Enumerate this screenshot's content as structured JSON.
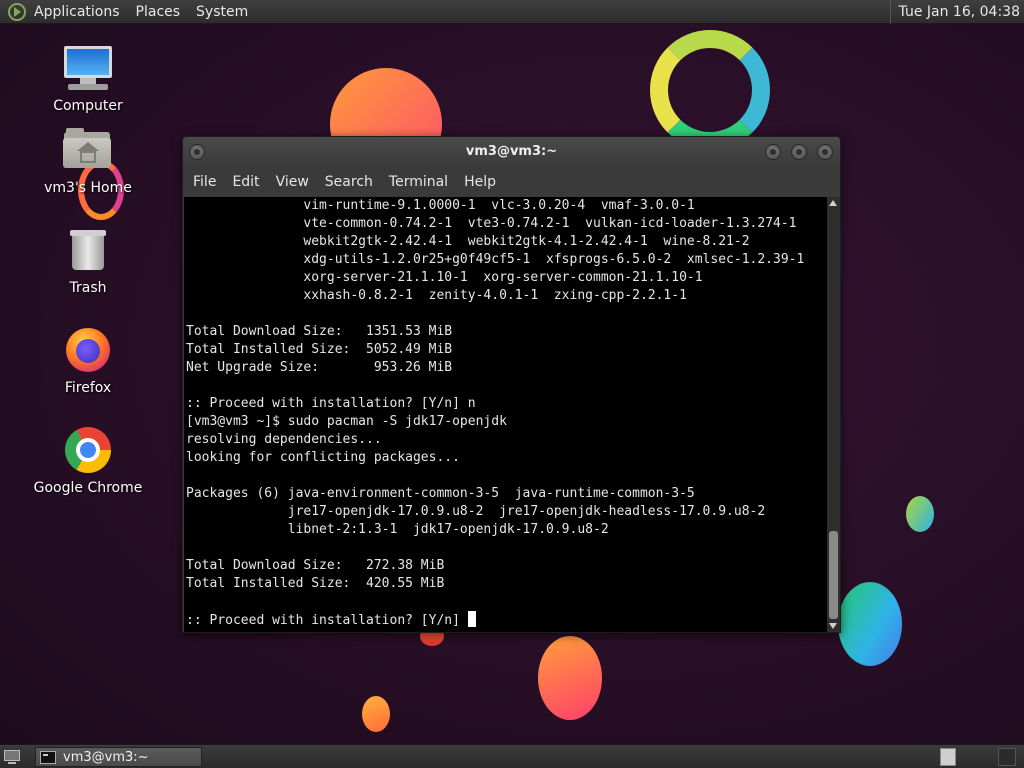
{
  "top_panel": {
    "menus": [
      "Applications",
      "Places",
      "System"
    ],
    "clock": "Tue Jan 16, 04:38"
  },
  "desktop_icons": [
    {
      "label": "Computer",
      "icon": "computer-icon"
    },
    {
      "label": "vm3's Home",
      "icon": "home-folder-icon"
    },
    {
      "label": "Trash",
      "icon": "trash-icon"
    },
    {
      "label": "Firefox",
      "icon": "firefox-icon"
    },
    {
      "label": "Google Chrome",
      "icon": "chrome-icon"
    }
  ],
  "terminal": {
    "title": "vm3@vm3:~",
    "menu": [
      "File",
      "Edit",
      "View",
      "Search",
      "Terminal",
      "Help"
    ],
    "lines": [
      "               vim-runtime-9.1.0000-1  vlc-3.0.20-4  vmaf-3.0.0-1",
      "               vte-common-0.74.2-1  vte3-0.74.2-1  vulkan-icd-loader-1.3.274-1",
      "               webkit2gtk-2.42.4-1  webkit2gtk-4.1-2.42.4-1  wine-8.21-2",
      "               xdg-utils-1.2.0r25+g0f49cf5-1  xfsprogs-6.5.0-2  xmlsec-1.2.39-1",
      "               xorg-server-21.1.10-1  xorg-server-common-21.1.10-1",
      "               xxhash-0.8.2-1  zenity-4.0.1-1  zxing-cpp-2.2.1-1",
      "",
      "Total Download Size:   1351.53 MiB",
      "Total Installed Size:  5052.49 MiB",
      "Net Upgrade Size:       953.26 MiB",
      "",
      ":: Proceed with installation? [Y/n] n",
      "[vm3@vm3 ~]$ sudo pacman -S jdk17-openjdk",
      "resolving dependencies...",
      "looking for conflicting packages...",
      "",
      "Packages (6) java-environment-common-3-5  java-runtime-common-3-5",
      "             jre17-openjdk-17.0.9.u8-2  jre17-openjdk-headless-17.0.9.u8-2",
      "             libnet-2:1.3-1  jdk17-openjdk-17.0.9.u8-2",
      "",
      "Total Download Size:   272.38 MiB",
      "Total Installed Size:  420.55 MiB",
      "",
      ":: Proceed with installation? [Y/n] "
    ]
  },
  "bottom_panel": {
    "taskbar_item": "vm3@vm3:~"
  },
  "colors": {
    "terminal_bg": "#000000",
    "terminal_fg": "#e6e6e6",
    "panel_bg": "#333333",
    "wallpaper": "#2a0f28"
  }
}
